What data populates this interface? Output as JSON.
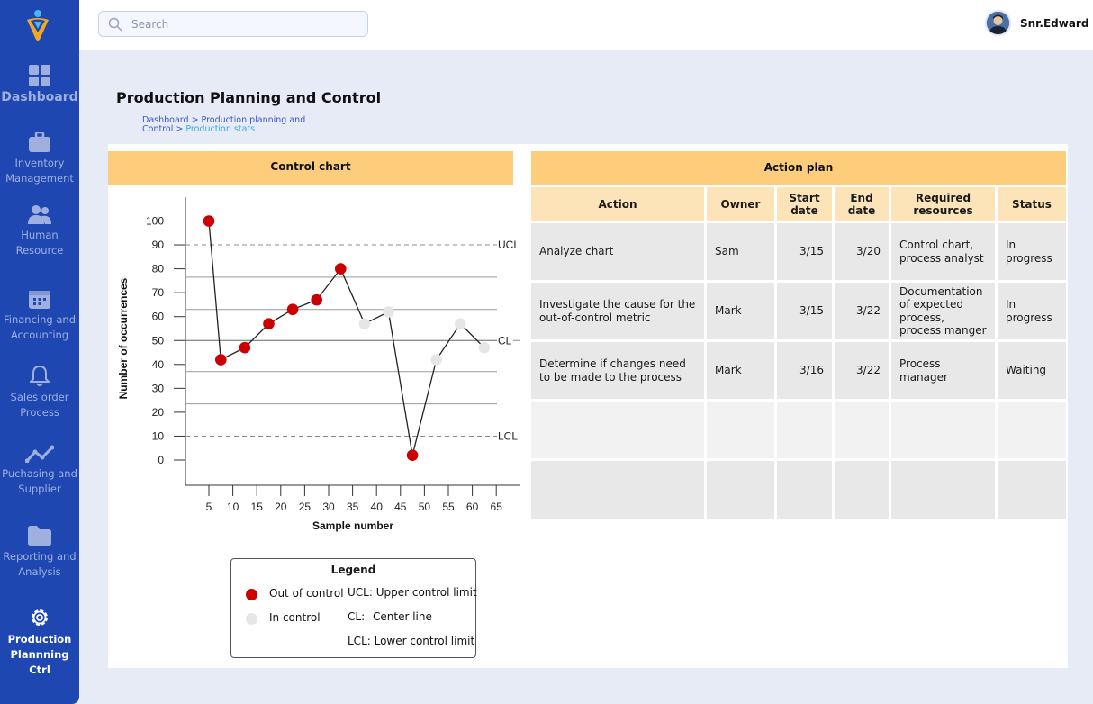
{
  "sidebar": {
    "items": [
      {
        "label": "Dashboard",
        "icon": "grid-icon"
      },
      {
        "label": "Inventory Management",
        "icon": "briefcase-icon"
      },
      {
        "label": "Human Resource",
        "icon": "users-icon"
      },
      {
        "label": "Financing and Accounting",
        "icon": "calendar-icon"
      },
      {
        "label": "Sales order Process",
        "icon": "bell-icon"
      },
      {
        "label": "Puchasing and Supplier",
        "icon": "trend-icon"
      },
      {
        "label": "Reporting and Analysis",
        "icon": "folder-icon"
      },
      {
        "label": "Production Plannning Ctrl",
        "icon": "gear-icon"
      }
    ],
    "active": "Production Plannning Ctrl"
  },
  "header": {
    "search_placeholder": "Search",
    "username": "Snr.Edward"
  },
  "page": {
    "title": "Production Planning and Control",
    "breadcrumb": [
      "Dashboard",
      "Production planning and Control",
      "Production stats"
    ]
  },
  "control_panel": {
    "header": "Control chart",
    "legend": {
      "title": "Legend",
      "out_label": "Out of control",
      "in_label": "In control",
      "ucl_text": "UCL: Upper control limit",
      "cl_key": "CL:",
      "cl_text": "Center line",
      "lcl_text": "LCL: Lower control limit"
    }
  },
  "chart_data": {
    "type": "line",
    "xlabel": "Sample number",
    "ylabel": "Number of occurrences",
    "xlim": [
      0,
      66
    ],
    "ylim": [
      -10,
      105
    ],
    "xticks": [
      5,
      10,
      15,
      20,
      25,
      30,
      35,
      40,
      45,
      50,
      55,
      60,
      65
    ],
    "yticks": [
      0,
      10,
      20,
      30,
      40,
      50,
      60,
      70,
      80,
      90,
      100
    ],
    "control_lines": [
      {
        "name": "UCL",
        "y": 90
      },
      {
        "name": "CL",
        "y": 50
      },
      {
        "name": "LCL",
        "y": 10
      }
    ],
    "zone_lines": [
      76.5,
      63,
      37,
      23.5
    ],
    "points": [
      {
        "x": 5,
        "y": 100,
        "status": "out"
      },
      {
        "x": 7.5,
        "y": 42,
        "status": "out"
      },
      {
        "x": 12.5,
        "y": 47,
        "status": "out"
      },
      {
        "x": 17.5,
        "y": 57,
        "status": "out"
      },
      {
        "x": 22.5,
        "y": 63,
        "status": "out"
      },
      {
        "x": 27.5,
        "y": 67,
        "status": "out"
      },
      {
        "x": 32.5,
        "y": 80,
        "status": "out"
      },
      {
        "x": 37.5,
        "y": 57,
        "status": "in"
      },
      {
        "x": 42.5,
        "y": 62,
        "status": "in"
      },
      {
        "x": 47.5,
        "y": 2,
        "status": "out"
      },
      {
        "x": 52.5,
        "y": 42,
        "status": "in"
      },
      {
        "x": 57.5,
        "y": 57,
        "status": "in"
      },
      {
        "x": 62.5,
        "y": 47,
        "status": "in"
      }
    ],
    "colors": {
      "out": "#cc0000",
      "in": "#e6e6e6",
      "line": "#222222"
    }
  },
  "action_plan": {
    "header": "Action plan",
    "columns": [
      "Action",
      "Owner",
      "Start date",
      "End date",
      "Required resources",
      "Status"
    ],
    "rows": [
      {
        "action": "Analyze chart",
        "owner": "Sam",
        "start": "3/15",
        "end": "3/20",
        "resources": "Control chart, process analyst",
        "status": "In progress"
      },
      {
        "action": "Investigate the cause for the out-of-control metric",
        "owner": "Mark",
        "start": "3/15",
        "end": "3/22",
        "resources": "Documentation of expected process, process manger",
        "status": "In progress"
      },
      {
        "action": "Determine if changes need to be made to the process",
        "owner": "Mark",
        "start": "3/16",
        "end": "3/22",
        "resources": "Process manager",
        "status": "Waiting"
      }
    ],
    "empty_rows": 2
  },
  "colors": {
    "sidebar": "#1f47b2",
    "accent": "#fdcd7c",
    "table_header": "#fde4b8",
    "active_marker": "#f5b700"
  }
}
